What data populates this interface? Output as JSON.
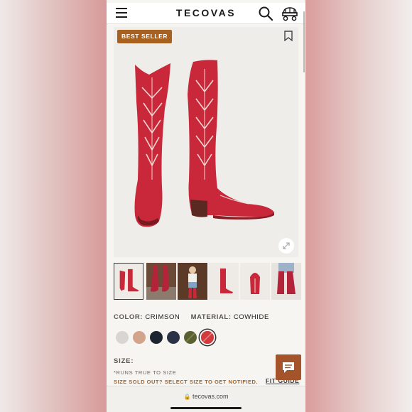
{
  "header": {
    "brand": "TECOVAS",
    "icons": [
      "menu-icon",
      "search-icon",
      "wagon-cart-icon"
    ]
  },
  "hero": {
    "badge": "BEST SELLER",
    "icons": [
      "bookmark-icon",
      "expand-icon"
    ]
  },
  "gallery": {
    "thumbnails": [
      "boots-pair",
      "boots-on-street",
      "model-in-store",
      "single-boot-side",
      "boot-toe-detail",
      "boots-worn-with-jeans"
    ],
    "active_index": 0
  },
  "product": {
    "color_label": "COLOR:",
    "color_value": "CRIMSON",
    "material_label": "MATERIAL:",
    "material_value": "COWHIDE"
  },
  "swatches": {
    "colors": [
      "#d9d6d2",
      "#d2a48c",
      "#1c2331",
      "#2b3248",
      "#5b6033",
      "#d23a3e"
    ],
    "selected_index": 5
  },
  "size": {
    "label": "SIZE:",
    "note": "*RUNS TRUE TO SIZE",
    "sold_out": "SIZE SOLD OUT? SELECT SIZE TO GET NOTIFIED.",
    "fit_guide": "FIT GUIDE"
  },
  "browser": {
    "url": "tecovas.com"
  },
  "colors": {
    "brand_brown": "#a9611f",
    "boot_red": "#c8283a",
    "chat_button": "#a5532a"
  }
}
